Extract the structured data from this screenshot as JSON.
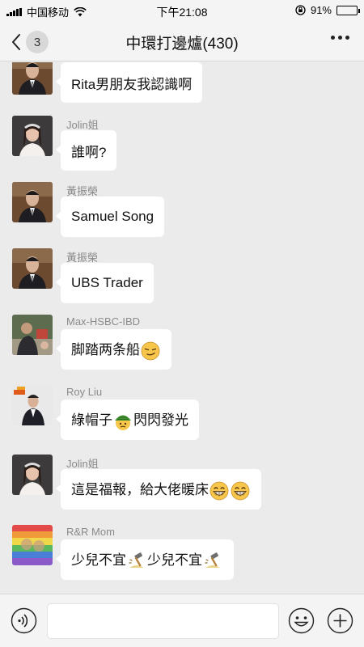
{
  "status": {
    "carrier": "中国移动",
    "time": "下午21:08",
    "battery": "91%",
    "battery_level": 0.91
  },
  "header": {
    "back_count": "3",
    "title": "中環打邊爐(430)"
  },
  "messages": [
    {
      "sender": "",
      "avatar": "suit-man-avatar",
      "parts": [
        {
          "t": "text",
          "v": "Rita男朋友我認識啊"
        }
      ]
    },
    {
      "sender": "Jolin姐",
      "avatar": "woman-avatar",
      "parts": [
        {
          "t": "text",
          "v": "誰啊?"
        }
      ]
    },
    {
      "sender": "黃振榮",
      "avatar": "suit-man-avatar",
      "parts": [
        {
          "t": "text",
          "v": "Samuel Song"
        }
      ]
    },
    {
      "sender": "黃振榮",
      "avatar": "suit-man-avatar",
      "parts": [
        {
          "t": "text",
          "v": "UBS Trader"
        }
      ]
    },
    {
      "sender": "Max-HSBC-IBD",
      "avatar": "photo-avatar",
      "parts": [
        {
          "t": "text",
          "v": "脚踏两条船"
        },
        {
          "t": "emoji",
          "v": "smirk"
        }
      ]
    },
    {
      "sender": "Roy Liu",
      "avatar": "pwc-avatar",
      "parts": [
        {
          "t": "text",
          "v": "綠帽子"
        },
        {
          "t": "emoji",
          "v": "green-hat"
        },
        {
          "t": "text",
          "v": "閃閃發光"
        }
      ]
    },
    {
      "sender": "Jolin姐",
      "avatar": "woman-avatar",
      "parts": [
        {
          "t": "text",
          "v": "這是福報，給大佬暖床"
        },
        {
          "t": "emoji",
          "v": "grin"
        },
        {
          "t": "emoji",
          "v": "grin"
        }
      ]
    },
    {
      "sender": "R&R Mom",
      "avatar": "rainbow-avatar",
      "parts": [
        {
          "t": "text",
          "v": "少兒不宜"
        },
        {
          "t": "emoji",
          "v": "hammer"
        },
        {
          "t": "text",
          "v": "少兒不宜"
        },
        {
          "t": "emoji",
          "v": "hammer"
        }
      ]
    }
  ],
  "input": {
    "placeholder": ""
  },
  "colors": {
    "background": "#ebebeb",
    "bubble": "#ffffff",
    "bars": "#f4f4f4",
    "sender_text": "#8a8a8a"
  }
}
